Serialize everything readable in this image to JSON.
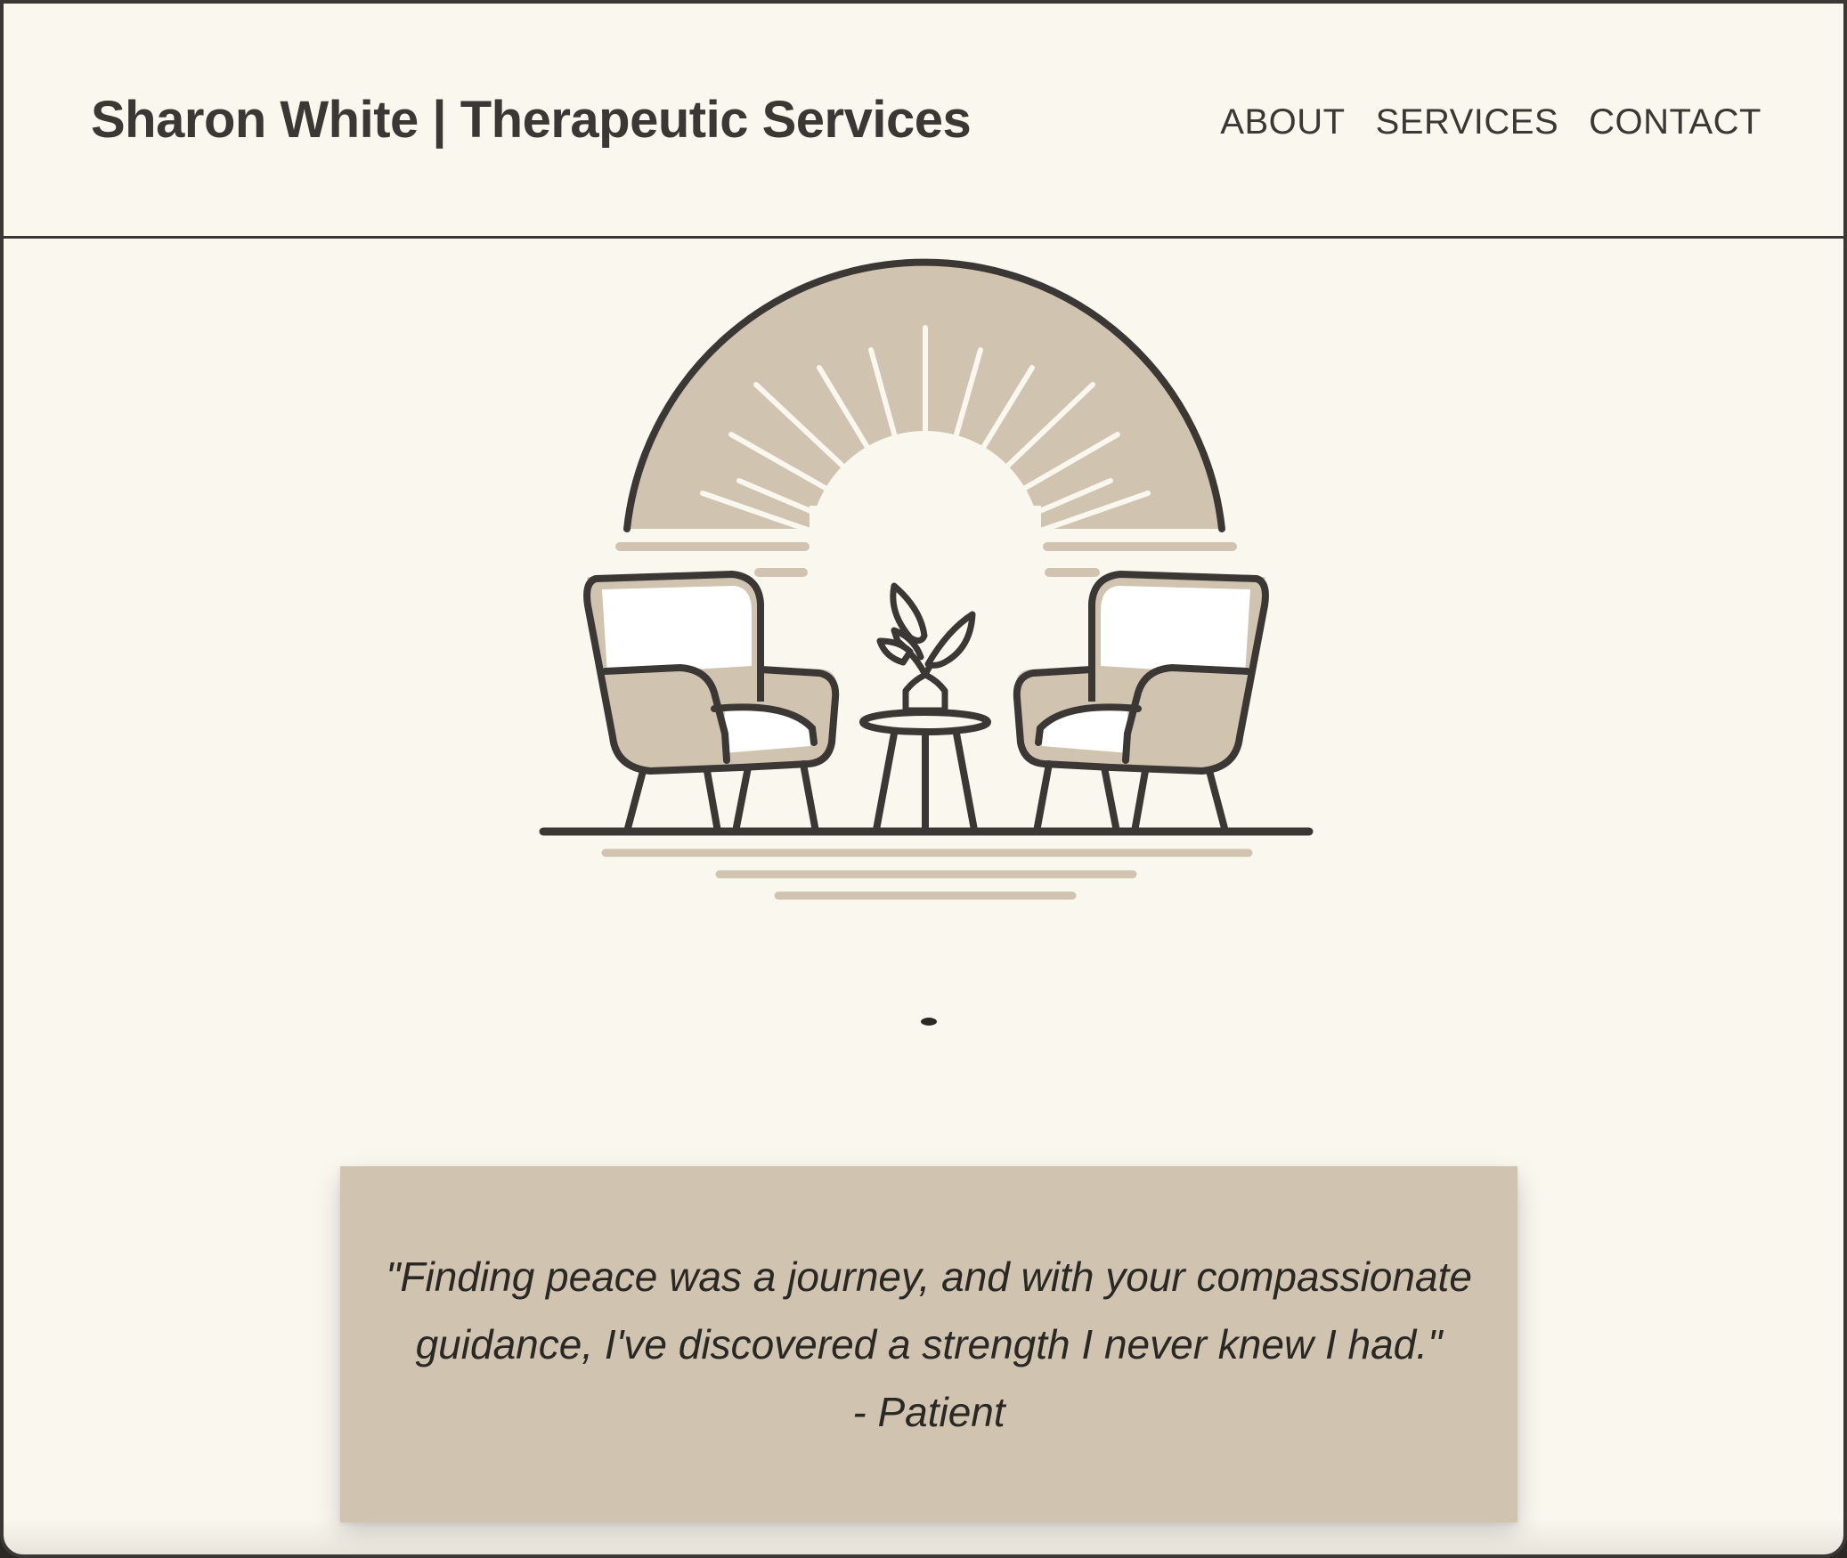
{
  "header": {
    "site_title": "Sharon White | Therapeutic Services",
    "nav": [
      {
        "label": "ABOUT"
      },
      {
        "label": "SERVICES"
      },
      {
        "label": "CONTACT"
      }
    ]
  },
  "hero": {
    "illustration_icon": "therapy-room-illustration-icon",
    "carousel_position": 1,
    "carousel_total": 1
  },
  "testimonial": {
    "quote": "\"Finding peace was a journey, and with your compassionate guidance, I've discovered a strength I never knew I had.\"",
    "attribution": "- Patient"
  },
  "colors": {
    "background": "#faf7ef",
    "accent_beige": "#d0c3af",
    "ink": "#3a3734"
  }
}
